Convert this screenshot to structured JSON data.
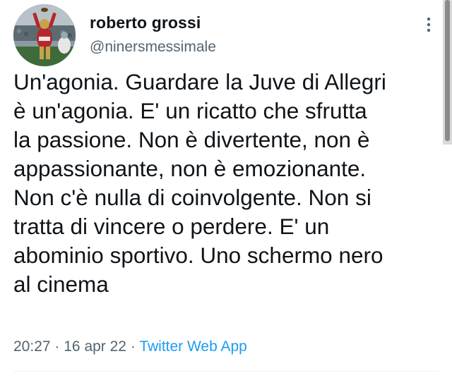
{
  "author": {
    "display_name": "roberto grossi",
    "handle": "@ninersmessimale",
    "avatar_icon": "football-player-avatar"
  },
  "tweet": {
    "lines": [
      "Un'agonia. Guardare la Juve di Allegri",
      "è un'agonia. E' un ricatto che sfrutta",
      "la passione. Non è divertente, non è",
      "appassionante, non è emozionante.",
      "Non c'è nulla di coinvolgente. Non si",
      "tratta di vincere o perdere. E' un",
      "abominio sportivo. Uno schermo nero",
      "al cinema"
    ]
  },
  "meta": {
    "time": "20:27",
    "separator": "·",
    "date": "16 apr 22",
    "source": "Twitter Web App"
  },
  "colors": {
    "text": "#0f1419",
    "secondary": "#536471",
    "link": "#1d9bf0"
  }
}
